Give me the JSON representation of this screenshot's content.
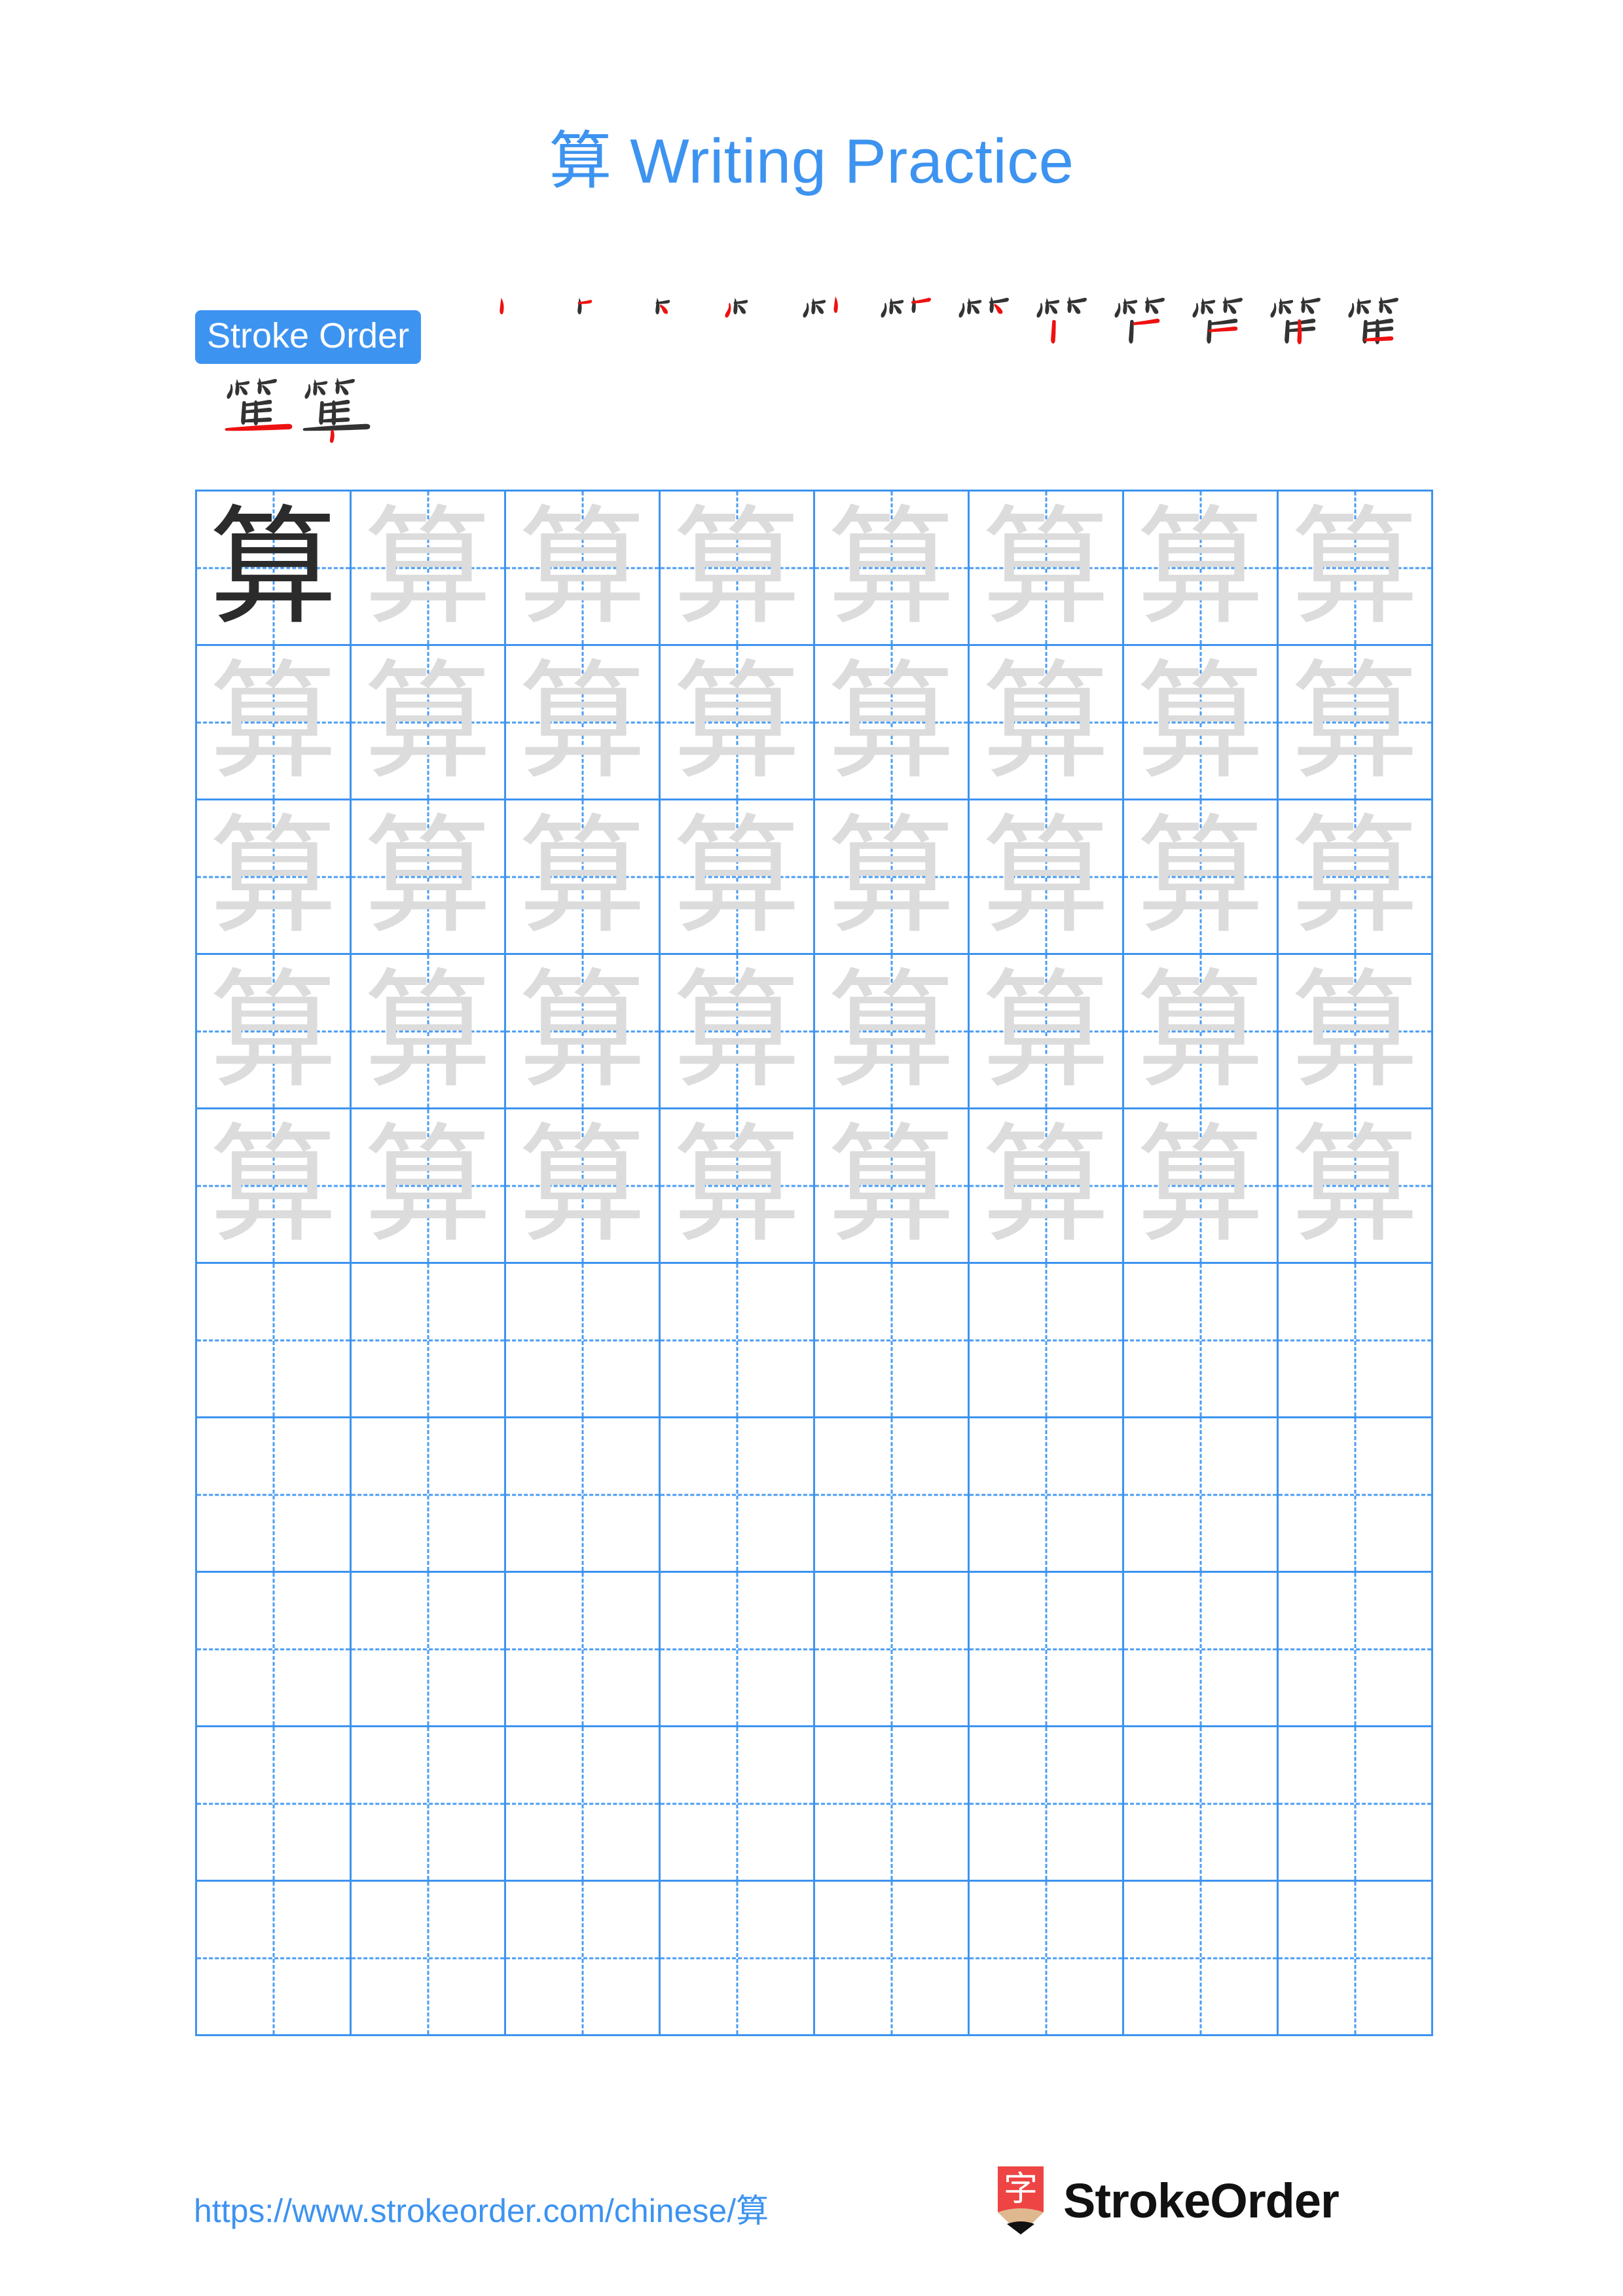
{
  "page": {
    "character": "算",
    "title_character": "算",
    "title_text": "Writing Practice",
    "background_color": "#ffffff",
    "accent_color": "#3d93f0",
    "stroke_new_color": "#ee1111",
    "stroke_done_color": "#333333",
    "trace_color": "#dcdcdc",
    "model_color": "#2b2b2b"
  },
  "stroke_order": {
    "label": "Stroke Order",
    "total_strokes": 14,
    "steps": [
      {
        "index": 1,
        "strokes_shown": 1
      },
      {
        "index": 2,
        "strokes_shown": 2
      },
      {
        "index": 3,
        "strokes_shown": 3
      },
      {
        "index": 4,
        "strokes_shown": 4
      },
      {
        "index": 5,
        "strokes_shown": 5
      },
      {
        "index": 6,
        "strokes_shown": 6
      },
      {
        "index": 7,
        "strokes_shown": 7
      },
      {
        "index": 8,
        "strokes_shown": 8
      },
      {
        "index": 9,
        "strokes_shown": 9
      },
      {
        "index": 10,
        "strokes_shown": 10
      },
      {
        "index": 11,
        "strokes_shown": 11
      },
      {
        "index": 12,
        "strokes_shown": 12
      },
      {
        "index": 13,
        "strokes_shown": 13
      },
      {
        "index": 14,
        "strokes_shown": 14
      }
    ]
  },
  "practice_grid": {
    "columns": 8,
    "rows": 10,
    "cell_size_px": 236,
    "filled_rows": 5,
    "model_cell": {
      "row": 1,
      "column": 1
    },
    "cells": [
      {
        "row": 1,
        "col": 1,
        "char": "算",
        "style": "dark"
      },
      {
        "row": 1,
        "col": 2,
        "char": "算",
        "style": "light"
      },
      {
        "row": 1,
        "col": 3,
        "char": "算",
        "style": "light"
      },
      {
        "row": 1,
        "col": 4,
        "char": "算",
        "style": "light"
      },
      {
        "row": 1,
        "col": 5,
        "char": "算",
        "style": "light"
      },
      {
        "row": 1,
        "col": 6,
        "char": "算",
        "style": "light"
      },
      {
        "row": 1,
        "col": 7,
        "char": "算",
        "style": "light"
      },
      {
        "row": 1,
        "col": 8,
        "char": "算",
        "style": "light"
      },
      {
        "row": 2,
        "col": 1,
        "char": "算",
        "style": "light"
      },
      {
        "row": 2,
        "col": 2,
        "char": "算",
        "style": "light"
      },
      {
        "row": 2,
        "col": 3,
        "char": "算",
        "style": "light"
      },
      {
        "row": 2,
        "col": 4,
        "char": "算",
        "style": "light"
      },
      {
        "row": 2,
        "col": 5,
        "char": "算",
        "style": "light"
      },
      {
        "row": 2,
        "col": 6,
        "char": "算",
        "style": "light"
      },
      {
        "row": 2,
        "col": 7,
        "char": "算",
        "style": "light"
      },
      {
        "row": 2,
        "col": 8,
        "char": "算",
        "style": "light"
      },
      {
        "row": 3,
        "col": 1,
        "char": "算",
        "style": "light"
      },
      {
        "row": 3,
        "col": 2,
        "char": "算",
        "style": "light"
      },
      {
        "row": 3,
        "col": 3,
        "char": "算",
        "style": "light"
      },
      {
        "row": 3,
        "col": 4,
        "char": "算",
        "style": "light"
      },
      {
        "row": 3,
        "col": 5,
        "char": "算",
        "style": "light"
      },
      {
        "row": 3,
        "col": 6,
        "char": "算",
        "style": "light"
      },
      {
        "row": 3,
        "col": 7,
        "char": "算",
        "style": "light"
      },
      {
        "row": 3,
        "col": 8,
        "char": "算",
        "style": "light"
      },
      {
        "row": 4,
        "col": 1,
        "char": "算",
        "style": "light"
      },
      {
        "row": 4,
        "col": 2,
        "char": "算",
        "style": "light"
      },
      {
        "row": 4,
        "col": 3,
        "char": "算",
        "style": "light"
      },
      {
        "row": 4,
        "col": 4,
        "char": "算",
        "style": "light"
      },
      {
        "row": 4,
        "col": 5,
        "char": "算",
        "style": "light"
      },
      {
        "row": 4,
        "col": 6,
        "char": "算",
        "style": "light"
      },
      {
        "row": 4,
        "col": 7,
        "char": "算",
        "style": "light"
      },
      {
        "row": 4,
        "col": 8,
        "char": "算",
        "style": "light"
      },
      {
        "row": 5,
        "col": 1,
        "char": "算",
        "style": "light"
      },
      {
        "row": 5,
        "col": 2,
        "char": "算",
        "style": "light"
      },
      {
        "row": 5,
        "col": 3,
        "char": "算",
        "style": "light"
      },
      {
        "row": 5,
        "col": 4,
        "char": "算",
        "style": "light"
      },
      {
        "row": 5,
        "col": 5,
        "char": "算",
        "style": "light"
      },
      {
        "row": 5,
        "col": 6,
        "char": "算",
        "style": "light"
      },
      {
        "row": 5,
        "col": 7,
        "char": "算",
        "style": "light"
      },
      {
        "row": 5,
        "col": 8,
        "char": "算",
        "style": "light"
      },
      {
        "row": 6,
        "col": 1,
        "char": "",
        "style": "empty"
      },
      {
        "row": 6,
        "col": 2,
        "char": "",
        "style": "empty"
      },
      {
        "row": 6,
        "col": 3,
        "char": "",
        "style": "empty"
      },
      {
        "row": 6,
        "col": 4,
        "char": "",
        "style": "empty"
      },
      {
        "row": 6,
        "col": 5,
        "char": "",
        "style": "empty"
      },
      {
        "row": 6,
        "col": 6,
        "char": "",
        "style": "empty"
      },
      {
        "row": 6,
        "col": 7,
        "char": "",
        "style": "empty"
      },
      {
        "row": 6,
        "col": 8,
        "char": "",
        "style": "empty"
      },
      {
        "row": 7,
        "col": 1,
        "char": "",
        "style": "empty"
      },
      {
        "row": 7,
        "col": 2,
        "char": "",
        "style": "empty"
      },
      {
        "row": 7,
        "col": 3,
        "char": "",
        "style": "empty"
      },
      {
        "row": 7,
        "col": 4,
        "char": "",
        "style": "empty"
      },
      {
        "row": 7,
        "col": 5,
        "char": "",
        "style": "empty"
      },
      {
        "row": 7,
        "col": 6,
        "char": "",
        "style": "empty"
      },
      {
        "row": 7,
        "col": 7,
        "char": "",
        "style": "empty"
      },
      {
        "row": 7,
        "col": 8,
        "char": "",
        "style": "empty"
      },
      {
        "row": 8,
        "col": 1,
        "char": "",
        "style": "empty"
      },
      {
        "row": 8,
        "col": 2,
        "char": "",
        "style": "empty"
      },
      {
        "row": 8,
        "col": 3,
        "char": "",
        "style": "empty"
      },
      {
        "row": 8,
        "col": 4,
        "char": "",
        "style": "empty"
      },
      {
        "row": 8,
        "col": 5,
        "char": "",
        "style": "empty"
      },
      {
        "row": 8,
        "col": 6,
        "char": "",
        "style": "empty"
      },
      {
        "row": 8,
        "col": 7,
        "char": "",
        "style": "empty"
      },
      {
        "row": 8,
        "col": 8,
        "char": "",
        "style": "empty"
      },
      {
        "row": 9,
        "col": 1,
        "char": "",
        "style": "empty"
      },
      {
        "row": 9,
        "col": 2,
        "char": "",
        "style": "empty"
      },
      {
        "row": 9,
        "col": 3,
        "char": "",
        "style": "empty"
      },
      {
        "row": 9,
        "col": 4,
        "char": "",
        "style": "empty"
      },
      {
        "row": 9,
        "col": 5,
        "char": "",
        "style": "empty"
      },
      {
        "row": 9,
        "col": 6,
        "char": "",
        "style": "empty"
      },
      {
        "row": 9,
        "col": 7,
        "char": "",
        "style": "empty"
      },
      {
        "row": 9,
        "col": 8,
        "char": "",
        "style": "empty"
      },
      {
        "row": 10,
        "col": 1,
        "char": "",
        "style": "empty"
      },
      {
        "row": 10,
        "col": 2,
        "char": "",
        "style": "empty"
      },
      {
        "row": 10,
        "col": 3,
        "char": "",
        "style": "empty"
      },
      {
        "row": 10,
        "col": 4,
        "char": "",
        "style": "empty"
      },
      {
        "row": 10,
        "col": 5,
        "char": "",
        "style": "empty"
      },
      {
        "row": 10,
        "col": 6,
        "char": "",
        "style": "empty"
      },
      {
        "row": 10,
        "col": 7,
        "char": "",
        "style": "empty"
      },
      {
        "row": 10,
        "col": 8,
        "char": "",
        "style": "empty"
      }
    ]
  },
  "footer": {
    "url": "https://www.strokeorder.com/chinese/算",
    "brand_name": "StrokeOrder",
    "logo_character": "字",
    "logo_color": "#ef4444",
    "logo_tip_color": "#e0b88f"
  }
}
